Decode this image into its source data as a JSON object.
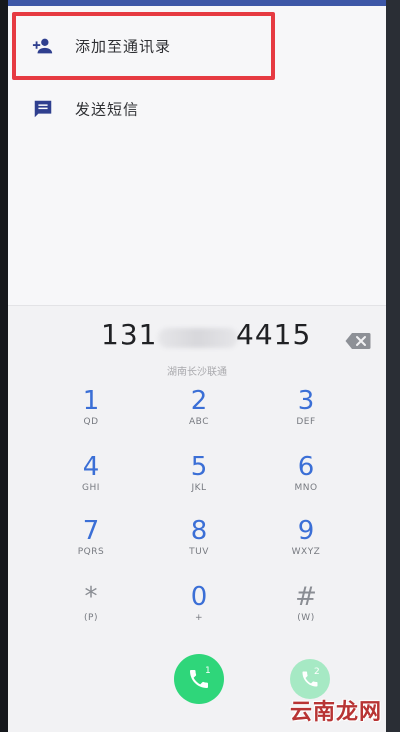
{
  "suggestions": [
    {
      "label": "添加至通讯录",
      "icon": "add-contact-icon"
    },
    {
      "label": "发送短信",
      "icon": "message-icon"
    }
  ],
  "dialer": {
    "number_prefix": "131",
    "number_suffix": "4415",
    "carrier": "湖南长沙联通",
    "keys": [
      {
        "digit": "1",
        "letters": "QD"
      },
      {
        "digit": "2",
        "letters": "ABC"
      },
      {
        "digit": "3",
        "letters": "DEF"
      },
      {
        "digit": "4",
        "letters": "GHI"
      },
      {
        "digit": "5",
        "letters": "JKL"
      },
      {
        "digit": "6",
        "letters": "MNO"
      },
      {
        "digit": "7",
        "letters": "PQRS"
      },
      {
        "digit": "8",
        "letters": "TUV"
      },
      {
        "digit": "9",
        "letters": "WXYZ"
      },
      {
        "digit": "*",
        "letters": "(P)"
      },
      {
        "digit": "0",
        "letters": "+"
      },
      {
        "digit": "#",
        "letters": "(W)"
      }
    ],
    "call_sim1": "1",
    "call_sim2": "2"
  },
  "watermark": "云南龙网",
  "colors": {
    "accent_blue": "#3b6fd6",
    "call_green": "#2fd67a",
    "highlight_red": "#e63a42"
  }
}
